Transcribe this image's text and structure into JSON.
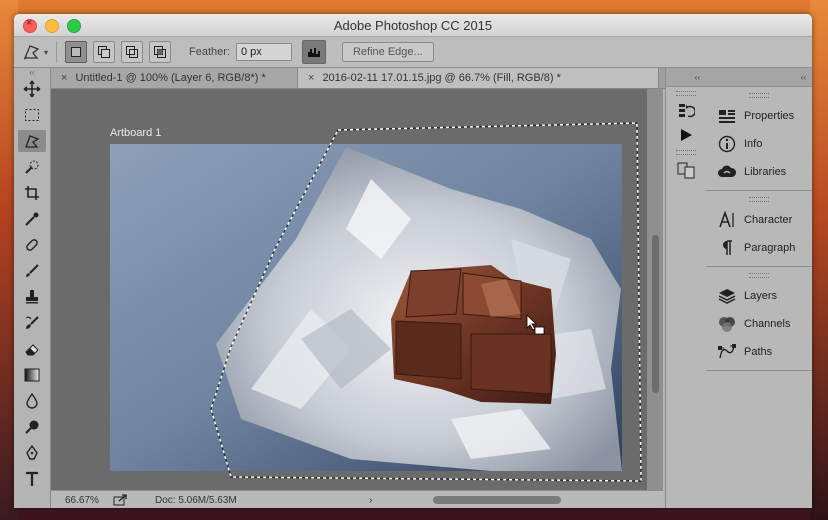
{
  "window": {
    "title": "Adobe Photoshop CC 2015"
  },
  "options_bar": {
    "feather_label": "Feather:",
    "feather_value": "0 px",
    "refine_edge_label": "Refine Edge..."
  },
  "tabs": [
    {
      "label": "Untitled-1 @ 100% (Layer 6, RGB/8*) *",
      "close": "×"
    },
    {
      "label": "2016-02-11 17.01.15.jpg @ 66.7% (Fill, RGB/8) *",
      "close": "×"
    }
  ],
  "canvas": {
    "artboard_label": "Artboard 1"
  },
  "status_bar": {
    "zoom": "66.67%",
    "doc_info": "Doc: 5.06M/5.63M",
    "arrow": "›"
  },
  "collapse_glyph": "‹‹",
  "right_panel": {
    "groups": [
      [
        {
          "label": "Properties",
          "icon": "properties-icon"
        },
        {
          "label": "Info",
          "icon": "info-icon"
        },
        {
          "label": "Libraries",
          "icon": "libraries-icon"
        }
      ],
      [
        {
          "label": "Character",
          "icon": "character-icon"
        },
        {
          "label": "Paragraph",
          "icon": "paragraph-icon"
        }
      ],
      [
        {
          "label": "Layers",
          "icon": "layers-icon"
        },
        {
          "label": "Channels",
          "icon": "channels-icon"
        },
        {
          "label": "Paths",
          "icon": "paths-icon"
        }
      ]
    ]
  }
}
